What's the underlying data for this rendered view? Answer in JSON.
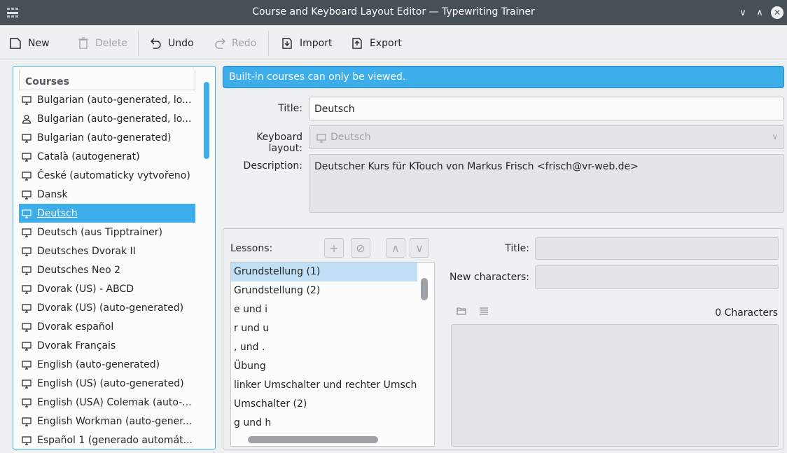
{
  "window": {
    "title": "Course and Keyboard Layout Editor — Typewriting Trainer",
    "app_icon": "app-grid-icon",
    "controls": [
      "minimize-icon",
      "maximize-icon",
      "close-icon"
    ]
  },
  "toolbar": {
    "new_label": "New",
    "delete_label": "Delete",
    "undo_label": "Undo",
    "redo_label": "Redo",
    "import_label": "Import",
    "export_label": "Export"
  },
  "courses": {
    "header": "Courses",
    "items": [
      {
        "label": "Bulgarian (auto-generated, lo...",
        "icon": "monitor-icon"
      },
      {
        "label": "Bulgarian (auto-generated, lo...",
        "icon": "user-icon"
      },
      {
        "label": "Bulgarian (auto-generated)",
        "icon": "monitor-icon"
      },
      {
        "label": "Català (autogenerat)",
        "icon": "monitor-icon"
      },
      {
        "label": "České (automaticky vytvořeno)",
        "icon": "monitor-icon"
      },
      {
        "label": "Dansk",
        "icon": "monitor-icon"
      },
      {
        "label": "Deutsch",
        "icon": "monitor-icon",
        "selected": true
      },
      {
        "label": "Deutsch (aus Tipptrainer)",
        "icon": "monitor-icon"
      },
      {
        "label": "Deutsches Dvorak II",
        "icon": "monitor-icon"
      },
      {
        "label": "Deutsches Neo 2",
        "icon": "monitor-icon"
      },
      {
        "label": "Dvorak (US) - ABCD",
        "icon": "monitor-icon"
      },
      {
        "label": "Dvorak (US) (auto-generated)",
        "icon": "monitor-icon"
      },
      {
        "label": "Dvorak español",
        "icon": "monitor-icon"
      },
      {
        "label": "Dvorak Français",
        "icon": "monitor-icon"
      },
      {
        "label": "English (auto-generated)",
        "icon": "monitor-icon"
      },
      {
        "label": "English (US) (auto-generated)",
        "icon": "monitor-icon"
      },
      {
        "label": "English (USA) Colemak (auto-...",
        "icon": "monitor-icon"
      },
      {
        "label": "English Workman (auto-gener...",
        "icon": "monitor-icon"
      },
      {
        "label": "Español 1 (generado automát...",
        "icon": "monitor-icon"
      }
    ]
  },
  "banner": {
    "message": "Built-in courses can only be viewed."
  },
  "course_form": {
    "title_label": "Title:",
    "title_value": "Deutsch",
    "layout_label": "Keyboard layout:",
    "layout_value": "Deutsch",
    "description_label": "Description:",
    "description_value": "Deutscher Kurs für KTouch von Markus Frisch <frisch@vr-web.de>"
  },
  "lessons": {
    "label": "Lessons:",
    "items": [
      {
        "label": "Grundstellung (1)",
        "selected": true
      },
      {
        "label": "Grundstellung (2)"
      },
      {
        "label": "e und i"
      },
      {
        "label": "r und u"
      },
      {
        "label": ", und ."
      },
      {
        "label": "Übung"
      },
      {
        "label": "linker Umschalter und rechter Umschalter"
      },
      {
        "label": "Umschalter (2)"
      },
      {
        "label": "g und h"
      }
    ],
    "title_label": "Title:",
    "title_value": "",
    "new_chars_label": "New characters:",
    "new_chars_value": "",
    "char_count": "0 Characters"
  },
  "colors": {
    "accent": "#3daee9",
    "titlebar": "#475057",
    "background": "#eff0f1"
  }
}
